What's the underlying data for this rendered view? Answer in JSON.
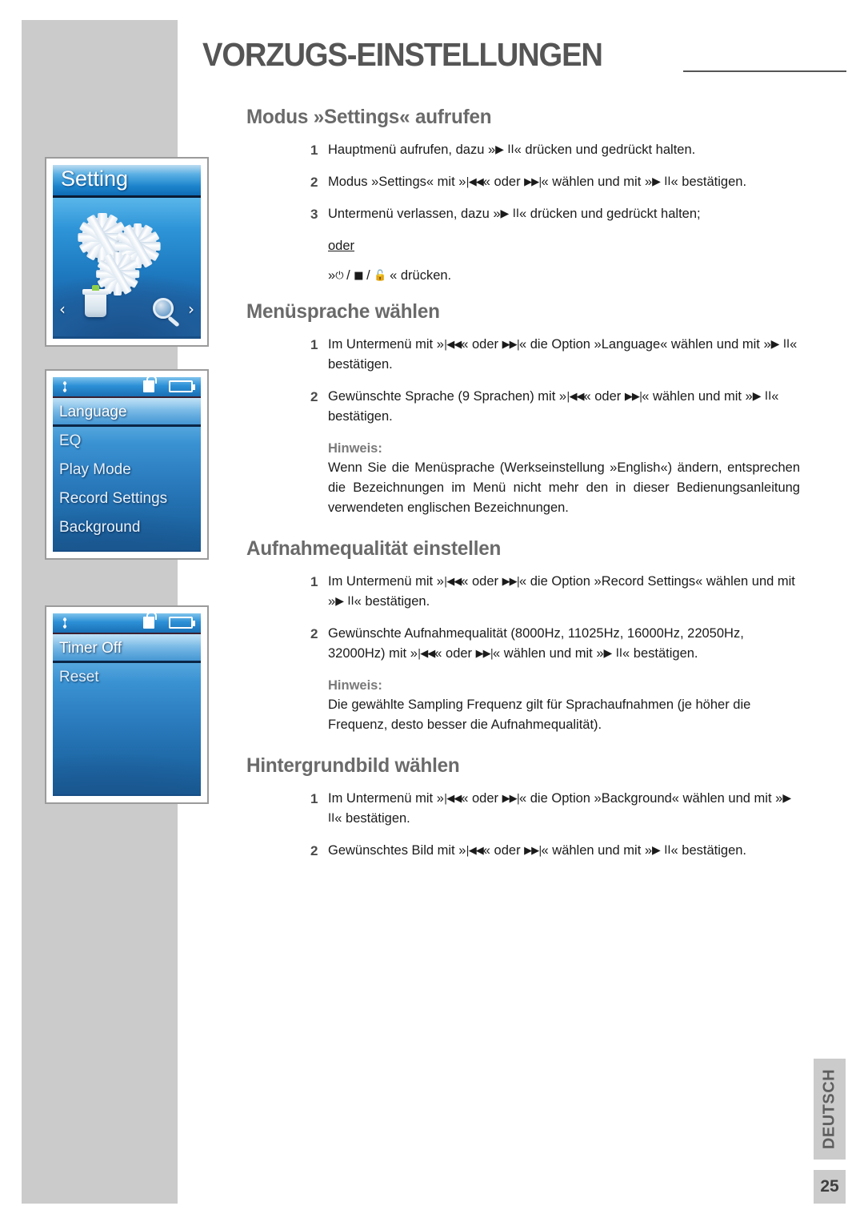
{
  "header": {
    "title": "VORZUGS-EINSTELLUNGEN",
    "rule": "horizontal-rule"
  },
  "devices": [
    {
      "name": "setting-screen",
      "title": "Setting",
      "icons": [
        "gear",
        "gear",
        "gear",
        "trash-bin",
        "magnifier"
      ],
      "nav_left": "‹",
      "nav_right": "›"
    },
    {
      "name": "settings-submenu-screen",
      "status_icons": [
        "wrench-icon",
        "lock-icon",
        "battery-icon"
      ],
      "items": [
        {
          "label": "Language",
          "selected": true
        },
        {
          "label": "EQ",
          "selected": false
        },
        {
          "label": "Play Mode",
          "selected": false
        },
        {
          "label": "Record Settings",
          "selected": false
        },
        {
          "label": "Background",
          "selected": false
        }
      ]
    },
    {
      "name": "settings-submenu-screen-2",
      "status_icons": [
        "wrench-icon",
        "lock-icon",
        "battery-icon"
      ],
      "items": [
        {
          "label": "Timer Off",
          "selected": true
        },
        {
          "label": "Reset",
          "selected": false
        }
      ]
    }
  ],
  "sections": [
    {
      "id": "modus-settings",
      "title": "Modus »Settings« aufrufen",
      "steps": [
        {
          "num": "1",
          "parts": [
            {
              "t": "text",
              "v": "Hauptmenü aufrufen, dazu »"
            },
            {
              "t": "glyph",
              "v": "▶ II"
            },
            {
              "t": "text",
              "v": "« drücken und gedrückt halten."
            }
          ]
        },
        {
          "num": "2",
          "parts": [
            {
              "t": "text",
              "v": "Modus »Settings« mit »"
            },
            {
              "t": "glyph",
              "v": "|◀◀"
            },
            {
              "t": "text",
              "v": "« oder "
            },
            {
              "t": "glyph",
              "v": "▶▶|"
            },
            {
              "t": "text",
              "v": "« wählen und mit »"
            },
            {
              "t": "glyph",
              "v": "▶ II"
            },
            {
              "t": "text",
              "v": "« bestätigen."
            }
          ]
        },
        {
          "num": "3",
          "parts": [
            {
              "t": "text",
              "v": "Untermenü verlassen, dazu »"
            },
            {
              "t": "glyph",
              "v": "▶ II"
            },
            {
              "t": "text",
              "v": "« drücken und gedrückt halten;"
            }
          ]
        }
      ],
      "oder_label": "oder",
      "oder_line_parts": [
        {
          "t": "text",
          "v": "»"
        },
        {
          "t": "glyph",
          "v": "⏻"
        },
        {
          "t": "text",
          "v": " / "
        },
        {
          "t": "glyph",
          "v": "■"
        },
        {
          "t": "text",
          "v": " / "
        },
        {
          "t": "glyph",
          "v": "🔓"
        },
        {
          "t": "text",
          "v": " « drücken."
        }
      ]
    },
    {
      "id": "menuesprache",
      "title": "Menüsprache wählen",
      "steps": [
        {
          "num": "1",
          "parts": [
            {
              "t": "text",
              "v": "Im Untermenü mit »"
            },
            {
              "t": "glyph",
              "v": "|◀◀"
            },
            {
              "t": "text",
              "v": "« oder "
            },
            {
              "t": "glyph",
              "v": "▶▶|"
            },
            {
              "t": "text",
              "v": "« die  Option »Language« wählen und mit »"
            },
            {
              "t": "glyph",
              "v": "▶ II"
            },
            {
              "t": "text",
              "v": "« bestätigen."
            }
          ]
        },
        {
          "num": "2",
          "parts": [
            {
              "t": "text",
              "v": "Gewünschte Sprache (9 Sprachen) mit »"
            },
            {
              "t": "glyph",
              "v": "|◀◀"
            },
            {
              "t": "text",
              "v": "« oder "
            },
            {
              "t": "glyph",
              "v": "▶▶|"
            },
            {
              "t": "text",
              "v": "« wählen und mit »"
            },
            {
              "t": "glyph",
              "v": "▶ II"
            },
            {
              "t": "text",
              "v": "« bestätigen."
            }
          ]
        }
      ],
      "note_label": "Hinweis:",
      "note_body": "Wenn Sie die Menüsprache (Werkseinstellung »English«) ändern, entsprechen die Bezeichnungen im Menü nicht mehr den in dieser Bedienungsanleitung verwendeten englischen Bezeichnungen.",
      "note_justify": true
    },
    {
      "id": "aufnahmequalitaet",
      "title": "Aufnahmequalität einstellen",
      "steps": [
        {
          "num": "1",
          "parts": [
            {
              "t": "text",
              "v": "Im Untermenü mit »"
            },
            {
              "t": "glyph",
              "v": "|◀◀"
            },
            {
              "t": "text",
              "v": "« oder "
            },
            {
              "t": "glyph",
              "v": "▶▶|"
            },
            {
              "t": "text",
              "v": "« die  Option »Record Settings« wählen und mit »"
            },
            {
              "t": "glyph",
              "v": "▶ II"
            },
            {
              "t": "text",
              "v": "« bestätigen."
            }
          ]
        },
        {
          "num": "2",
          "parts": [
            {
              "t": "text",
              "v": "Gewünschte Aufnahmequalität (8000Hz, 11025Hz, 16000Hz, 22050Hz, 32000Hz) mit »"
            },
            {
              "t": "glyph",
              "v": "|◀◀"
            },
            {
              "t": "text",
              "v": "« oder "
            },
            {
              "t": "glyph",
              "v": "▶▶|"
            },
            {
              "t": "text",
              "v": "« wählen und mit »"
            },
            {
              "t": "glyph",
              "v": "▶ II"
            },
            {
              "t": "text",
              "v": "« bestätigen."
            }
          ]
        }
      ],
      "note_label": "Hinweis:",
      "note_body": "Die gewählte Sampling Frequenz gilt für Sprachaufnahmen (je höher die Frequenz, desto besser die Aufnahmequalität).",
      "note_justify": false
    },
    {
      "id": "hintergrundbild",
      "title": "Hintergrundbild wählen",
      "steps": [
        {
          "num": "1",
          "parts": [
            {
              "t": "text",
              "v": "Im Untermenü mit »"
            },
            {
              "t": "glyph",
              "v": "|◀◀"
            },
            {
              "t": "text",
              "v": "« oder "
            },
            {
              "t": "glyph",
              "v": "▶▶|"
            },
            {
              "t": "text",
              "v": "« die  Option »Background« wählen und mit »"
            },
            {
              "t": "glyph",
              "v": "▶ II"
            },
            {
              "t": "text",
              "v": "« bestätigen."
            }
          ]
        },
        {
          "num": "2",
          "parts": [
            {
              "t": "text",
              "v": "Gewünschtes Bild mit »"
            },
            {
              "t": "glyph",
              "v": "|◀◀"
            },
            {
              "t": "text",
              "v": "« oder "
            },
            {
              "t": "glyph",
              "v": "▶▶|"
            },
            {
              "t": "text",
              "v": "« wählen und mit »"
            },
            {
              "t": "glyph",
              "v": "▶ II"
            },
            {
              "t": "text",
              "v": "« bestätigen."
            }
          ]
        }
      ]
    }
  ],
  "footer": {
    "language_tab": "DEUTSCH",
    "page_number": "25"
  },
  "colors": {
    "band_gray": "#cbcbcb",
    "heading_gray": "#6a6a6a",
    "title_gray": "#555555",
    "body_black": "#1b1b1b",
    "screen_blue": "#2a7bbd"
  }
}
